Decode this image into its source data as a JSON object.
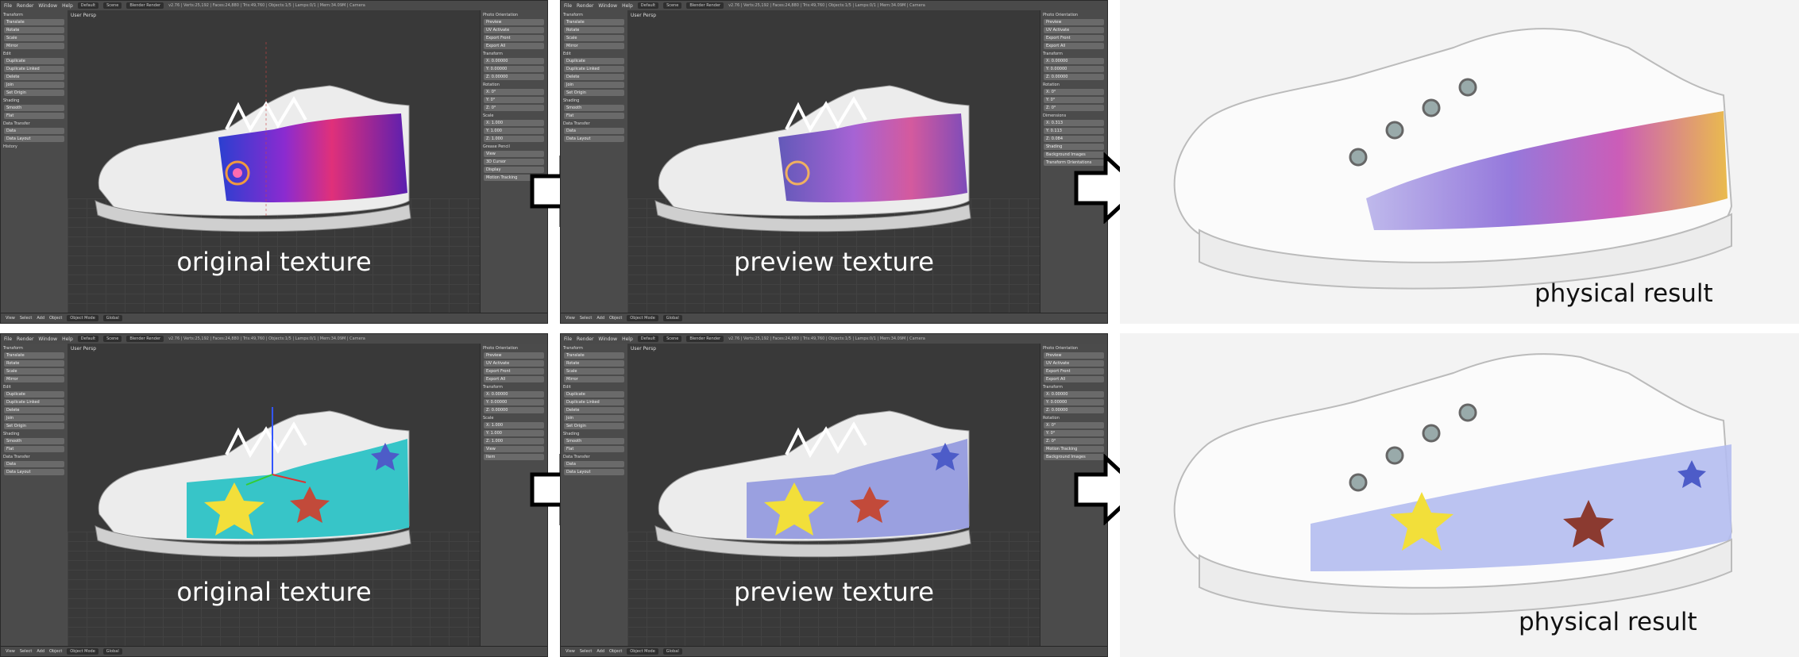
{
  "blender_ui": {
    "menus": [
      "File",
      "Render",
      "Window",
      "Help"
    ],
    "layout": "Default",
    "scene": "Scene",
    "engine": "Blender Render",
    "stats": "v2.76 | Verts:25,192 | Faces:24,880 | Tris:49,760 | Objects:1/5 | Lamps:0/1 | Mem:34.09M | Camera",
    "view_label": "User Persp",
    "bottom_menus": [
      "View",
      "Select",
      "Add",
      "Object"
    ],
    "mode": "Object Mode",
    "global": "Global",
    "tool_sections": [
      {
        "title": "Transform",
        "items": [
          "Translate",
          "Rotate",
          "Scale",
          "Mirror"
        ]
      },
      {
        "title": "Edit",
        "items": [
          "Duplicate",
          "Duplicate Linked",
          "Delete",
          "Join",
          "Set Origin"
        ]
      },
      {
        "title": "Shading",
        "items": [
          "Smooth",
          "Flat"
        ]
      },
      {
        "title": "Data Transfer",
        "items": [
          "Data",
          "Data Layout"
        ]
      },
      {
        "title": "History",
        "items": []
      }
    ],
    "props_sections": [
      {
        "title": "Photo Orientation",
        "items": [
          "Preview",
          "UV Activate",
          "Export Front",
          "Export All"
        ]
      },
      {
        "title": "Transform",
        "items": [
          "X: 0.00000",
          "Y: 0.00000",
          "Z: 0.00000"
        ]
      },
      {
        "title": "Rotation",
        "items": [
          "X: 0°",
          "Y: 0°",
          "Z: 0°"
        ]
      },
      {
        "title": "Scale",
        "items": [
          "X: 1.000",
          "Y: 1.000",
          "Z: 1.000"
        ]
      },
      {
        "title": "Dimensions",
        "items": [
          "X: 0.313",
          "Y: 0.113",
          "Z: 0.084"
        ]
      },
      {
        "title": "Grease Pencil",
        "items": [
          "View",
          "3D Cursor",
          "Item",
          "Display",
          "Shading",
          "Motion Tracking",
          "Background Images",
          "Transform Orientations"
        ]
      }
    ]
  },
  "captions": {
    "top_left": "original texture",
    "top_middle": "preview texture",
    "top_right": "physical result",
    "bottom_left": "original texture",
    "bottom_middle": "preview texture",
    "bottom_right": "physical result"
  },
  "colors": {
    "blender_bg": "#393939",
    "texture_top_a": "#6a2bd0",
    "texture_top_b": "#e0307a",
    "texture_bottom_teal": "#37c5c8",
    "texture_bottom_lavender": "#9aa0e0",
    "star_yellow": "#f2df3a",
    "star_red": "#c24a3a",
    "star_blue": "#4d5cc8"
  }
}
